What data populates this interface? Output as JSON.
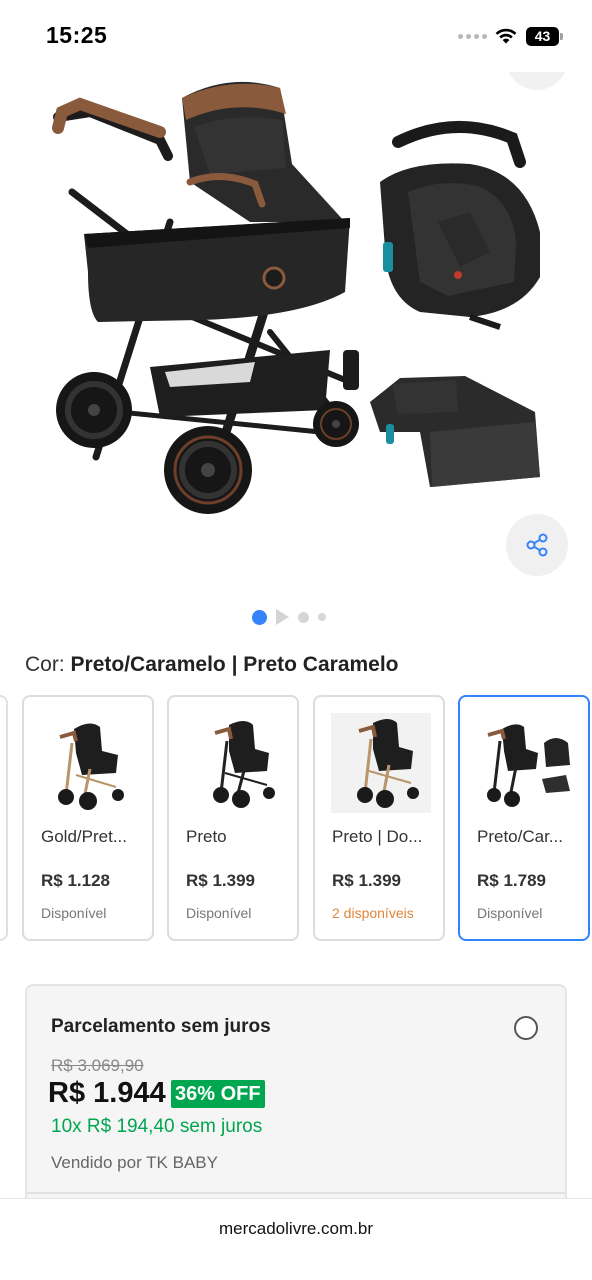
{
  "status_bar": {
    "time": "15:25",
    "battery": "43",
    "icons": [
      "cellular-dots-icon",
      "wifi-icon",
      "battery-icon"
    ]
  },
  "gallery": {
    "image_alt": "stroller-bassinet-carseat-base-product-image",
    "share_icon": "share-icon",
    "pagination": {
      "current": 1,
      "total": 4,
      "has_video": true
    }
  },
  "color_picker": {
    "label": "Cor: ",
    "value": "Preto/Caramelo | Preto Caramelo"
  },
  "variants": [
    {
      "name": "Gold/Pret...",
      "price": "R$ 1.128",
      "stock": "Disponível",
      "low_stock": false,
      "selected": false
    },
    {
      "name": "Preto",
      "price": "R$ 1.399",
      "stock": "Disponível",
      "low_stock": false,
      "selected": false
    },
    {
      "name": "Preto | Do...",
      "price": "R$ 1.399",
      "stock": "2 disponíveis",
      "low_stock": true,
      "selected": false
    },
    {
      "name": "Preto/Car...",
      "price": "R$ 1.789",
      "stock": "Disponível",
      "low_stock": false,
      "selected": true
    }
  ],
  "price_box": {
    "title": "Parcelamento sem juros",
    "old_price": "R$ 3.069,90",
    "price": "R$ 1.944",
    "discount": "36% OFF",
    "installments": "10x R$ 194,40 sem juros",
    "seller": "Vendido por TK BABY"
  },
  "browser": {
    "url": "mercadolivre.com.br"
  },
  "colors": {
    "accent_blue": "#3483fa",
    "discount_green": "#00a650",
    "low_stock_orange": "#e0853a",
    "stroller_black": "#222222",
    "handle_caramel": "#8a5a3c"
  }
}
